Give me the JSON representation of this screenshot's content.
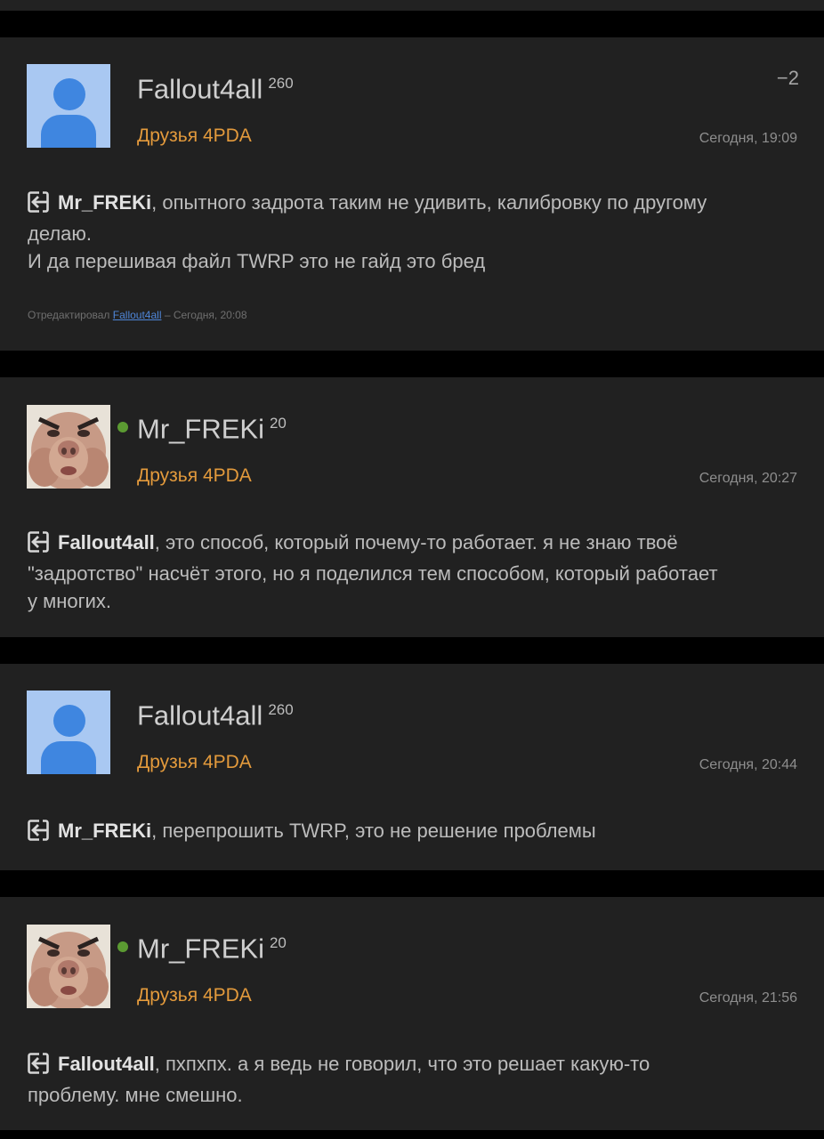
{
  "posts": [
    {
      "username": "Fallout4all",
      "reputation": "260",
      "group": "Друзья 4PDA",
      "date": "Сегодня, 19:09",
      "rating": "−2",
      "mention": "Mr_FREKi",
      "text_line1": ", опытного задрота таким не удивить, калибровку по другому",
      "text_line2": "делаю.",
      "text_line3": "И да перешивая файл TWRP это не гайд это бред",
      "edited_prefix": "Отредактировал",
      "edited_by": "Fallout4all",
      "edited_suffix": " – Сегодня, 20:08"
    },
    {
      "username": "Mr_FREKi",
      "reputation": "20",
      "group": "Друзья 4PDA",
      "date": "Сегодня, 20:27",
      "mention": "Fallout4all",
      "text_line1": ", это способ, который почему-то работает. я не знаю твоё",
      "text_line2": "\"задротство\" насчёт этого, но я поделился тем способом, который работает",
      "text_line3": "у многих."
    },
    {
      "username": "Fallout4all",
      "reputation": "260",
      "group": "Друзья 4PDA",
      "date": "Сегодня, 20:44",
      "mention": "Mr_FREKi",
      "text_line1": ", перепрошить TWRP, это не решение проблемы"
    },
    {
      "username": "Mr_FREKi",
      "reputation": "20",
      "group": "Друзья 4PDA",
      "date": "Сегодня, 21:56",
      "mention": "Fallout4all",
      "text_line1": ", пхпхпх. а я ведь не говорил, что это решает какую-то",
      "text_line2": "проблему. мне смешно."
    }
  ],
  "colors": {
    "group": "#e39a3c",
    "online": "#5b9a32",
    "link": "#4f86d8",
    "card": "#212121",
    "avatar_bg": "#a9c8f2",
    "avatar_fg": "#3f86e0"
  },
  "icons": {
    "quote": "quote-arrow-icon",
    "default_avatar": "default-user-avatar"
  }
}
